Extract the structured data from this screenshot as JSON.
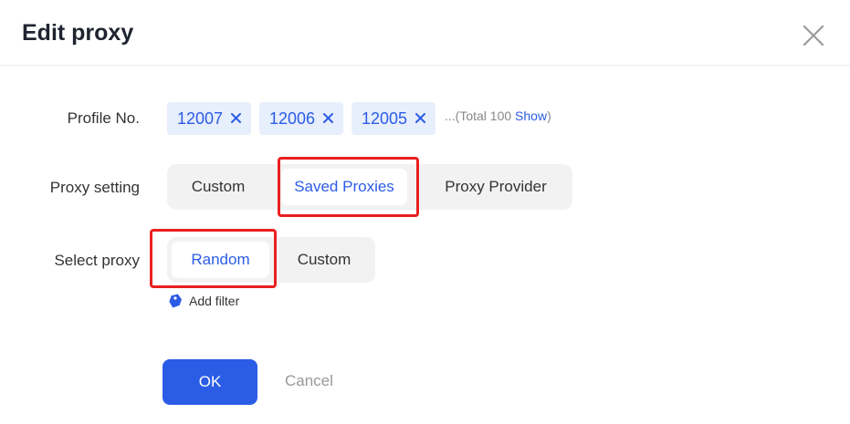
{
  "dialog": {
    "title": "Edit proxy"
  },
  "profile": {
    "label": "Profile No.",
    "tags": [
      "12007",
      "12006",
      "12005"
    ],
    "total_prefix": "...(Total 100 ",
    "show_label": "Show",
    "total_suffix": ")"
  },
  "proxy_setting": {
    "label": "Proxy setting",
    "options": [
      "Custom",
      "Saved Proxies",
      "Proxy Provider"
    ],
    "selected": "Saved Proxies"
  },
  "select_proxy": {
    "label": "Select proxy",
    "options": [
      "Random",
      "Custom"
    ],
    "selected": "Random",
    "add_filter_label": "Add filter"
  },
  "footer": {
    "ok_label": "OK",
    "cancel_label": "Cancel"
  },
  "colors": {
    "accent": "#2b5ce6",
    "highlight": "#e8201f",
    "tag_bg": "#e7eefc",
    "segment_bg": "#f2f2f2"
  },
  "icons": {
    "close": "close-icon",
    "tag_remove": "close-icon",
    "filter": "tag-icon"
  }
}
